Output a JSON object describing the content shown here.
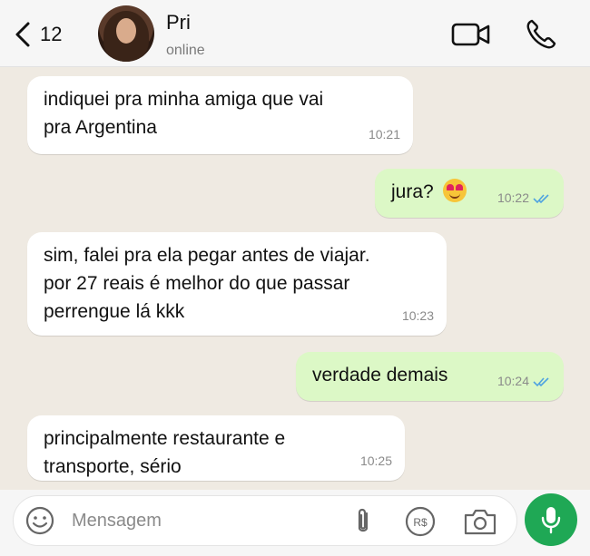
{
  "header": {
    "back_count": "12",
    "contact_name": "Pri",
    "contact_status": "online"
  },
  "messages": [
    {
      "direction": "in",
      "text": "indiquei pra minha amiga que vai\npra Argentina",
      "time": "10:21"
    },
    {
      "direction": "out",
      "text": "jura?",
      "emoji": "smiling-face-with-heart-eyes",
      "time": "10:22",
      "read": true
    },
    {
      "direction": "in",
      "text": "sim, falei pra ela pegar antes de viajar.\npor 27 reais é melhor do que passar\nperrengue lá kkk",
      "time": "10:23"
    },
    {
      "direction": "out",
      "text": "verdade demais",
      "time": "10:24",
      "read": true
    },
    {
      "direction": "in",
      "text": "principalmente restaurante e\ntransporte, sério",
      "time": "10:25"
    }
  ],
  "composer": {
    "placeholder": "Mensagem",
    "value": ""
  },
  "colors": {
    "incoming_bubble": "#ffffff",
    "outgoing_bubble": "#dcf8c6",
    "chat_background": "#efeae2",
    "read_ticks": "#4fa3e0",
    "mic_button": "#1fa855"
  }
}
